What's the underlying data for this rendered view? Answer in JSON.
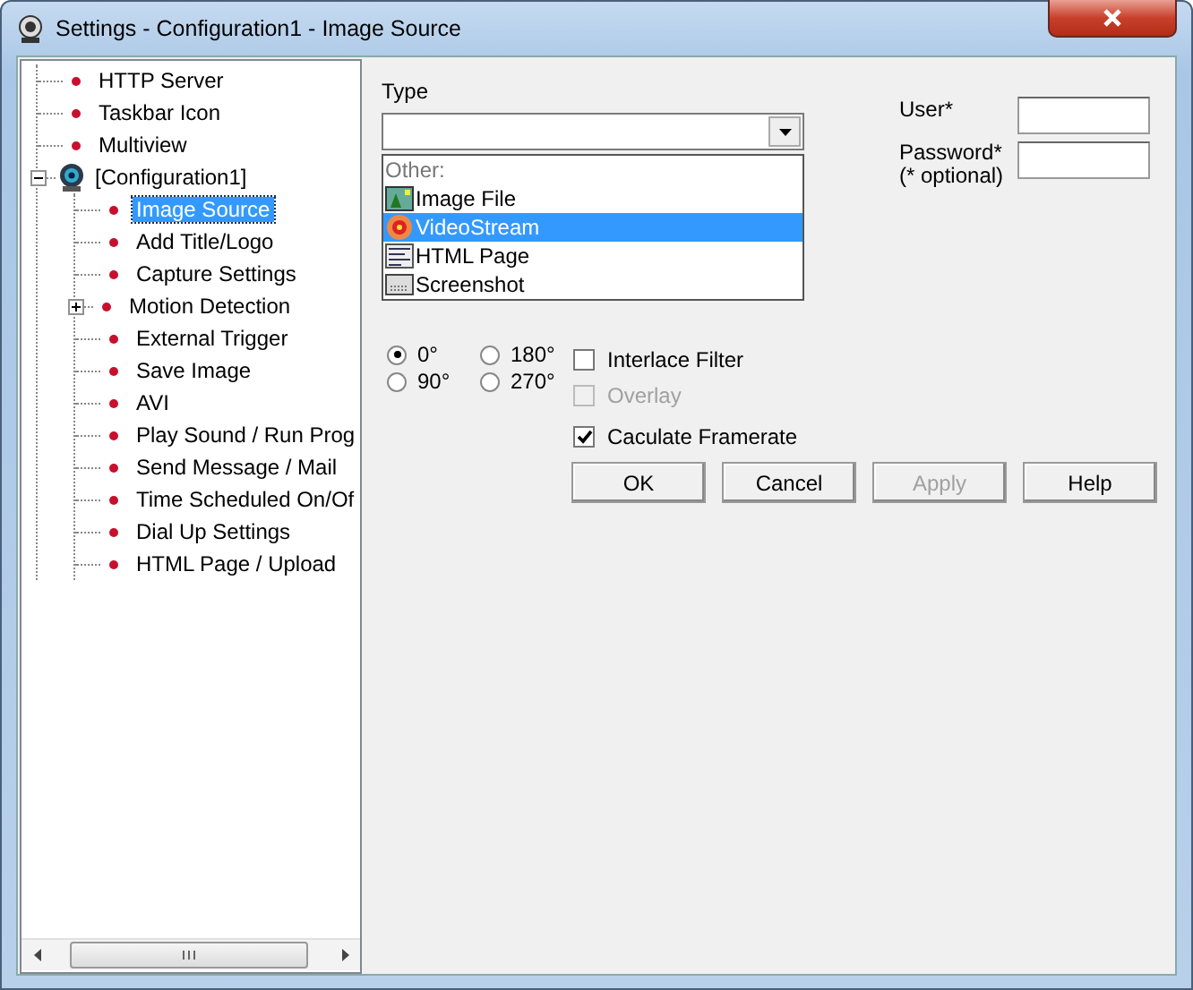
{
  "window": {
    "title": "Settings - Configuration1 - Image Source"
  },
  "tree": [
    {
      "label": "HTTP Server",
      "selected": false
    },
    {
      "label": "Taskbar Icon",
      "selected": false
    },
    {
      "label": "Multiview",
      "selected": false
    },
    {
      "label": "[Configuration1]",
      "selected": false,
      "kind": "camera",
      "expanded": true,
      "children": [
        {
          "label": "Image Source",
          "selected": true
        },
        {
          "label": "Add Title/Logo",
          "selected": false
        },
        {
          "label": "Capture Settings",
          "selected": false
        },
        {
          "label": "Motion Detection",
          "selected": false,
          "expanded": false
        },
        {
          "label": "External Trigger",
          "selected": false
        },
        {
          "label": "Save Image",
          "selected": false
        },
        {
          "label": "AVI",
          "selected": false
        },
        {
          "label": "Play Sound / Run Prog",
          "selected": false
        },
        {
          "label": "Send Message / Mail",
          "selected": false
        },
        {
          "label": "Time Scheduled On/Of",
          "selected": false
        },
        {
          "label": "Dial Up Settings",
          "selected": false
        },
        {
          "label": "HTML Page / Upload",
          "selected": false
        }
      ]
    }
  ],
  "type_label": "Type",
  "type_dropdown": [
    {
      "label": "Other:",
      "kind": "header",
      "selected": false
    },
    {
      "label": "Image File",
      "kind": "image",
      "selected": false
    },
    {
      "label": "VideoStream",
      "kind": "video",
      "selected": true
    },
    {
      "label": "HTML Page",
      "kind": "html",
      "selected": false
    },
    {
      "label": "Screenshot",
      "kind": "screen",
      "selected": false
    }
  ],
  "user_label": "User*",
  "password_label": "Password*",
  "optional_note": "(* optional)",
  "rotation": [
    {
      "label": "0°",
      "selected": true
    },
    {
      "label": "180°",
      "selected": false
    },
    {
      "label": "90°",
      "selected": false
    },
    {
      "label": "270°",
      "selected": false
    }
  ],
  "options": [
    {
      "label": "Interlace Filter",
      "checked": false,
      "disabled": false
    },
    {
      "label": "Overlay",
      "checked": false,
      "disabled": true
    },
    {
      "label": "Caculate Framerate",
      "checked": true,
      "disabled": false
    }
  ],
  "buttons": [
    {
      "label": "OK",
      "disabled": false
    },
    {
      "label": "Cancel",
      "disabled": false
    },
    {
      "label": "Apply",
      "disabled": true
    },
    {
      "label": "Help",
      "disabled": false
    }
  ]
}
